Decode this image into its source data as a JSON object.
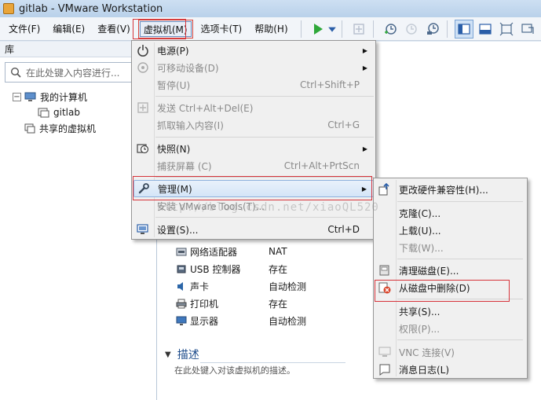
{
  "window": {
    "title": "gitlab - VMware Workstation"
  },
  "menubar": {
    "items": [
      "文件(F)",
      "编辑(E)",
      "查看(V)",
      "虚拟机(M)",
      "选项卡(T)",
      "帮助(H)"
    ]
  },
  "toolbar": {
    "icons": [
      "play-icon",
      "dropdown-icon",
      "send-keys-icon",
      "snapshot-icon",
      "revert-snapshot-icon",
      "snapshot-manager-icon",
      "library-view-icon",
      "console-view-icon",
      "fullscreen-icon",
      "unity-icon"
    ]
  },
  "library": {
    "header": "库",
    "search_placeholder": "在此处键入内容进行...",
    "tree": {
      "my_computer": "我的计算机",
      "vm": "gitlab",
      "shared": "共享的虚拟机"
    }
  },
  "content": {
    "hardware": [
      {
        "name": "网络适配器",
        "value": "NAT"
      },
      {
        "name": "USB 控制器",
        "value": "存在"
      },
      {
        "name": "声卡",
        "value": "自动检测"
      },
      {
        "name": "打印机",
        "value": "存在"
      },
      {
        "name": "显示器",
        "value": "自动检测"
      }
    ],
    "description_header": "描述",
    "description_placeholder": "在此处键入对该虚拟机的描述。"
  },
  "vm_menu": {
    "items": [
      {
        "label": "电源(P)",
        "submenu": true,
        "enabled": true
      },
      {
        "label": "可移动设备(D)",
        "submenu": true,
        "enabled": false
      },
      {
        "label": "暂停(U)",
        "shortcut": "Ctrl+Shift+P",
        "enabled": false
      },
      {
        "label": "发送 Ctrl+Alt+Del(E)",
        "enabled": false
      },
      {
        "label": "抓取输入内容(I)",
        "shortcut": "Ctrl+G",
        "enabled": false
      },
      {
        "label": "快照(N)",
        "submenu": true,
        "enabled": true
      },
      {
        "label": "捕获屏幕 (C)",
        "shortcut": "Ctrl+Alt+PrtScn",
        "enabled": false
      },
      {
        "label": "管理(M)",
        "submenu": true,
        "enabled": true,
        "highlighted": true
      },
      {
        "label": "安装 VMware Tools(T)...",
        "enabled": false
      },
      {
        "label": "设置(S)...",
        "shortcut": "Ctrl+D",
        "enabled": true
      }
    ]
  },
  "manage_menu": {
    "items": [
      {
        "label": "更改硬件兼容性(H)...",
        "enabled": true
      },
      {
        "label": "克隆(C)...",
        "enabled": true
      },
      {
        "label": "上载(U)...",
        "enabled": true
      },
      {
        "label": "下载(W)...",
        "enabled": false
      },
      {
        "label": "清理磁盘(E)...",
        "enabled": true
      },
      {
        "label": "从磁盘中删除(D)",
        "enabled": true
      },
      {
        "label": "共享(S)...",
        "enabled": true
      },
      {
        "label": "权限(P)...",
        "enabled": false
      },
      {
        "label": "VNC 连接(V)",
        "enabled": false
      },
      {
        "label": "消息日志(L)",
        "enabled": true
      }
    ]
  },
  "watermark": "http://blog.csdn.net/xiaoQL520"
}
